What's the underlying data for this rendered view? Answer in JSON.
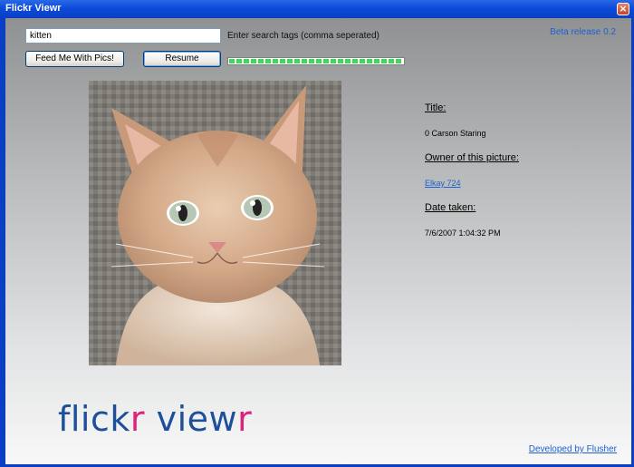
{
  "window": {
    "title": "Flickr Viewr",
    "close_icon": "close-icon",
    "close_glyph": "×"
  },
  "search": {
    "value": "kitten",
    "hint": "Enter search tags (comma seperated)"
  },
  "version_label": "Beta release 0.2",
  "buttons": {
    "feed": "Feed Me With Pics!",
    "resume": "Resume"
  },
  "progress": {
    "fraction": 1.0
  },
  "photo": {
    "subject": "kitten-photo"
  },
  "info": {
    "title_label": "Title:",
    "title_value": "0 Carson Staring",
    "owner_label": "Owner of this picture:",
    "owner_value": "Elkay 724",
    "date_label": "Date taken:",
    "date_value": "7/6/2007 1:04:32 PM"
  },
  "logo": {
    "part1": "flick",
    "part2": "r",
    "part3": " view",
    "part4": "r"
  },
  "footer": {
    "developer_link": "Developed by Flusher"
  },
  "colors": {
    "titlebar": "#0a3fc4",
    "link": "#2060d0",
    "logo_blue": "#1e4f9a",
    "logo_pink": "#e0217a",
    "progress": "#3fd65a"
  }
}
